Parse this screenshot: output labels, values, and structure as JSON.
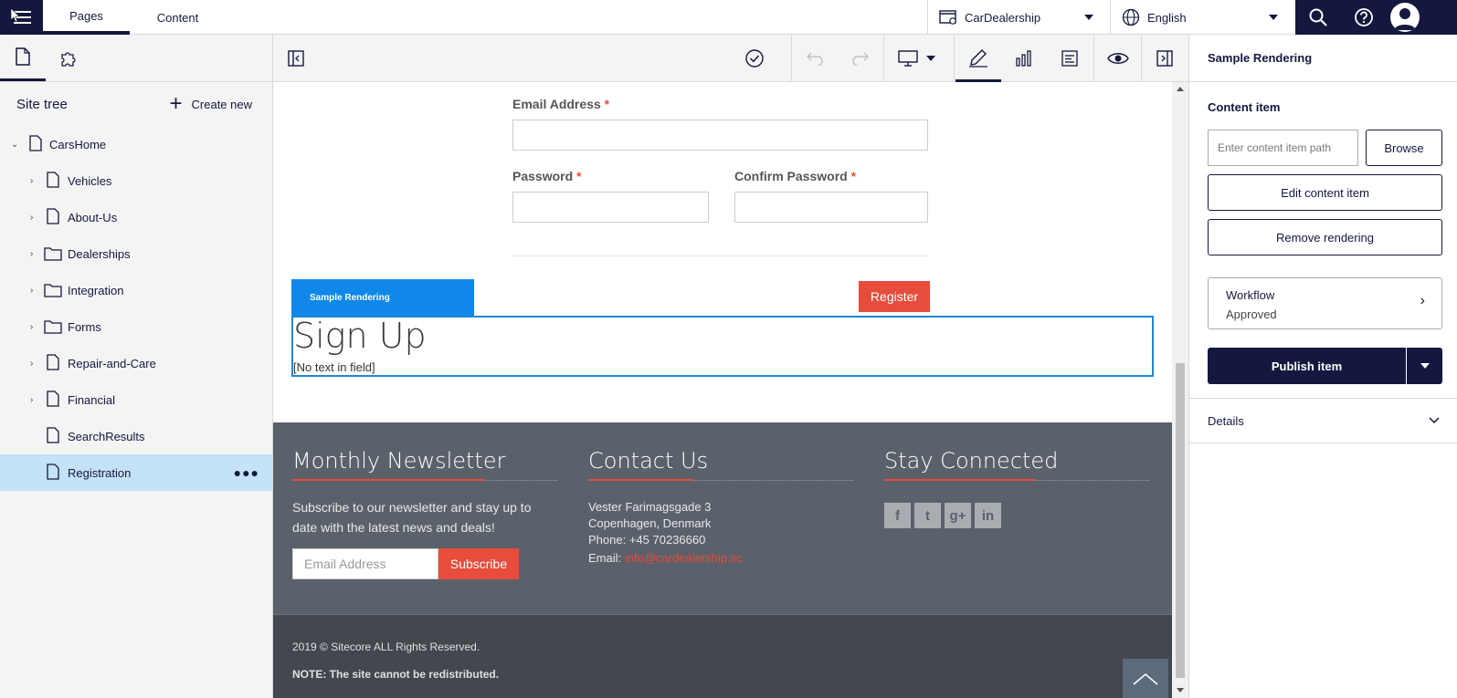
{
  "topbar": {
    "tabs": [
      {
        "label": "Pages"
      },
      {
        "label": "Content"
      }
    ],
    "site": "CarDealership",
    "language": "English"
  },
  "left": {
    "title": "Site tree",
    "create_new": "Create new",
    "tree": [
      {
        "label": "CarsHome"
      },
      {
        "label": "Vehicles"
      },
      {
        "label": "About-Us"
      },
      {
        "label": "Dealerships"
      },
      {
        "label": "Integration"
      },
      {
        "label": "Forms"
      },
      {
        "label": "Repair-and-Care"
      },
      {
        "label": "Financial"
      },
      {
        "label": "SearchResults"
      },
      {
        "label": "Registration"
      }
    ]
  },
  "form": {
    "email_label": "Email Address",
    "password_label": "Password",
    "confirm_label": "Confirm Password",
    "required_mark": "*",
    "register": "Register"
  },
  "rendering": {
    "chip": "Sample Rendering",
    "heading": "Sign Up",
    "empty_field": "[No text in field]"
  },
  "footer": {
    "newsletter_title": "Monthly Newsletter",
    "newsletter_text": "Subscribe to our newsletter and stay up to date with the latest news and deals!",
    "email_placeholder": "Email Address",
    "subscribe": "Subscribe",
    "contact_title": "Contact Us",
    "address1": "Vester Farimagsgade 3",
    "address2": "Copenhagen, Denmark",
    "phone": "Phone: +45 70236660",
    "email_label": "Email:",
    "email": "info@cardealership.sc",
    "social_title": "Stay Connected",
    "social": [
      "f",
      "t",
      "g+",
      "in"
    ],
    "copyright": "2019 © Sitecore ALL Rights Reserved.",
    "note": "NOTE: The site cannot be redistributed."
  },
  "right": {
    "title": "Sample Rendering",
    "content_item": "Content item",
    "path_placeholder": "Enter content item path",
    "browse": "Browse",
    "edit": "Edit content item",
    "remove": "Remove rendering",
    "workflow_label": "Workflow",
    "workflow_state": "Approved",
    "publish": "Publish item",
    "details": "Details"
  },
  "colors": {
    "navy": "#14183f",
    "accent_red": "#e74c3c",
    "selection_blue": "#1f86d9"
  }
}
